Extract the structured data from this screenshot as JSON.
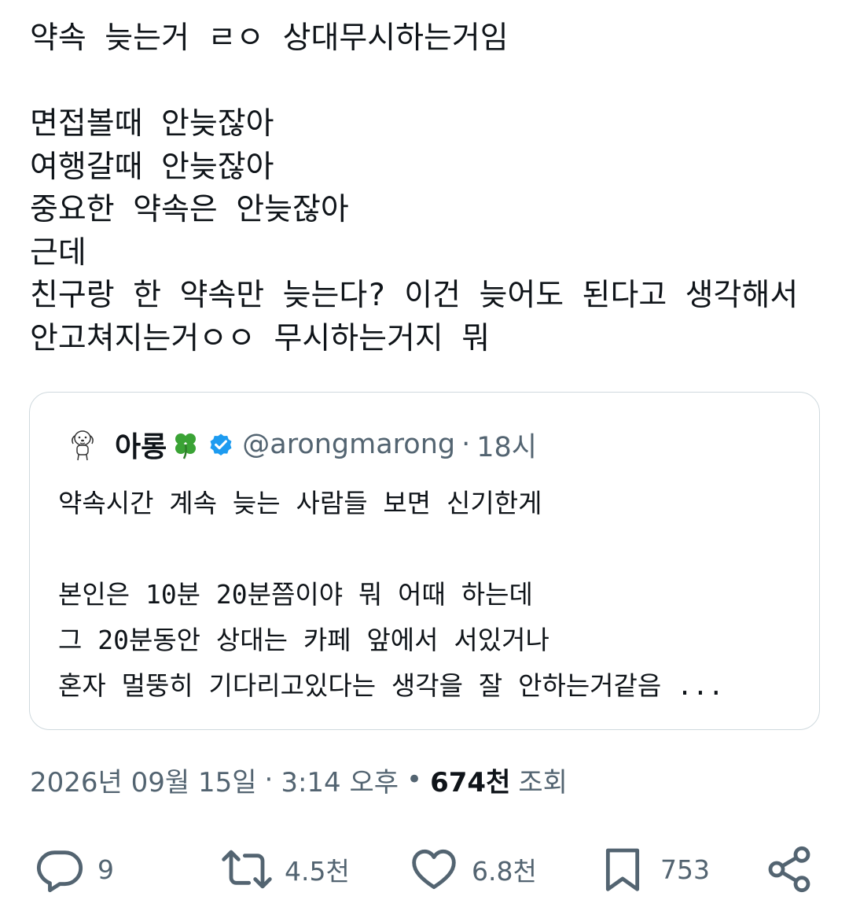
{
  "tweet": {
    "text": "약속 늦는거 ㄹㅇ 상대무시하는거임\n\n면접볼때 안늦잖아\n여행갈때 안늦잖아\n중요한 약속은 안늦잖아\n근데\n친구랑 한 약속만 늦는다? 이건 늦어도 된다고 생각해서\n안고쳐지는거ㅇㅇ 무시하는거지 뭐"
  },
  "quote": {
    "name": "아롱",
    "handle": "@arongmarong",
    "separator": "·",
    "time": "18시",
    "text": "약속시간 계속 늦는 사람들 보면 신기한게\n\n본인은 10분 20분쯤이야 뭐 어때 하는데\n그 20분동안 상대는 카페 앞에서 서있거나\n혼자 멀뚱히 기다리고있다는 생각을 잘 안하는거같음 ..."
  },
  "meta": {
    "date": "2026년 09월 15일",
    "sep1": "·",
    "time": "3:14 오후",
    "sep2": "•",
    "views": "674천",
    "views_label": "조회"
  },
  "actions": {
    "replies": "9",
    "retweets": "4.5천",
    "likes": "6.8천",
    "bookmarks": "753"
  },
  "icons": {
    "reply": "reply-icon",
    "retweet": "retweet-icon",
    "like": "heart-icon",
    "bookmark": "bookmark-icon",
    "share": "share-icon",
    "verified": "verified-badge-icon",
    "clover": "four-leaf-clover-icon",
    "avatar": "dog-avatar"
  },
  "colors": {
    "text": "#0f1419",
    "secondary": "#536471",
    "border": "#cfd9de",
    "verified": "#1d9bf0",
    "clover": "#3aa335"
  }
}
